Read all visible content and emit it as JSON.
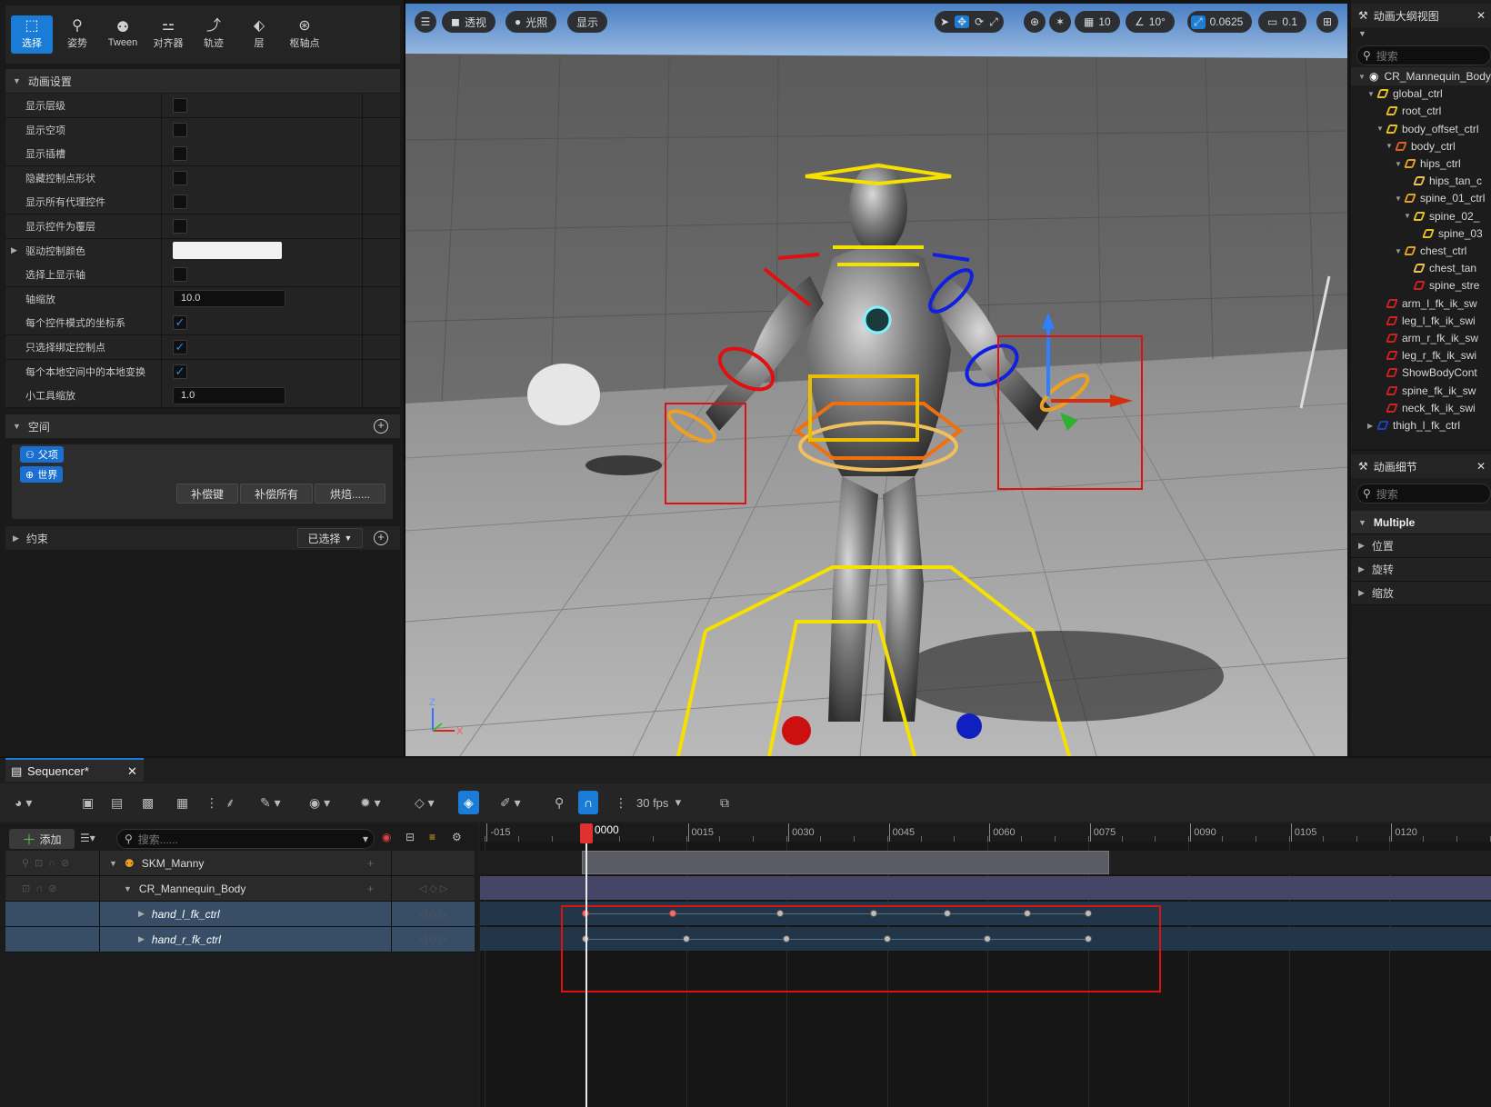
{
  "modes": [
    {
      "label": "选择",
      "icon": "select-icon",
      "active": true
    },
    {
      "label": "姿势",
      "icon": "pose-icon"
    },
    {
      "label": "Tween",
      "icon": "tween-icon"
    },
    {
      "label": "对齐器",
      "icon": "aligner-icon"
    },
    {
      "label": "轨迹",
      "icon": "trail-icon"
    },
    {
      "label": "层",
      "icon": "layers-icon"
    },
    {
      "label": "枢轴点",
      "icon": "pivot-icon"
    }
  ],
  "anim_settings": {
    "title": "动画设置",
    "rows": [
      {
        "label": "显示层级",
        "type": "checkbox",
        "checked": false
      },
      {
        "label": "显示空项",
        "type": "checkbox",
        "checked": false
      },
      {
        "label": "显示插槽",
        "type": "checkbox",
        "checked": false
      },
      {
        "label": "隐藏控制点形状",
        "type": "checkbox",
        "checked": false
      },
      {
        "label": "显示所有代理控件",
        "type": "checkbox",
        "checked": false
      },
      {
        "label": "显示控件为覆层",
        "type": "checkbox",
        "checked": false
      },
      {
        "label": "驱动控制颜色",
        "type": "color"
      },
      {
        "label": "选择上显示轴",
        "type": "checkbox",
        "checked": false
      },
      {
        "label": "轴缩放",
        "type": "number",
        "value": "10.0"
      },
      {
        "label": "每个控件模式的坐标系",
        "type": "checkbox",
        "checked": true
      },
      {
        "label": "只选择绑定控制点",
        "type": "checkbox",
        "checked": true
      },
      {
        "label": "每个本地空间中的本地变换",
        "type": "checkbox",
        "checked": true
      },
      {
        "label": "小工具缩放",
        "type": "number",
        "value": "1.0"
      }
    ]
  },
  "space": {
    "title": "空间",
    "chips": [
      "父项",
      "世界"
    ],
    "buttons": [
      "补偿键",
      "补偿所有",
      "烘焙......"
    ]
  },
  "constraints": {
    "title": "约束",
    "dropdown": "已选择"
  },
  "viewport": {
    "menu_icon": "hamburger-icon",
    "perspective": "透视",
    "lit": "光照",
    "show": "显示",
    "grid_snap": "10",
    "rot_snap": "10°",
    "scale_snap": "0.0625",
    "cam_speed": "0.1"
  },
  "outliner": {
    "title": "动画大纲视图",
    "search_placeholder": "搜索",
    "items": [
      {
        "label": "CR_Mannequin_Body",
        "indent": 0,
        "color": "#ffffff",
        "eye": true
      },
      {
        "label": "global_ctrl",
        "indent": 1,
        "color": "#e8c020"
      },
      {
        "label": "root_ctrl",
        "indent": 2,
        "color": "#e8c020"
      },
      {
        "label": "body_offset_ctrl",
        "indent": 2,
        "color": "#e8c020"
      },
      {
        "label": "body_ctrl",
        "indent": 3,
        "color": "#e06020"
      },
      {
        "label": "hips_ctrl",
        "indent": 4,
        "color": "#e8a020"
      },
      {
        "label": "hips_tan_c",
        "indent": 5,
        "color": "#f0c050"
      },
      {
        "label": "spine_01_ctrl",
        "indent": 4,
        "color": "#e8a020"
      },
      {
        "label": "spine_02_",
        "indent": 5,
        "color": "#e8c020"
      },
      {
        "label": "spine_03",
        "indent": 6,
        "color": "#e8c020"
      },
      {
        "label": "chest_ctrl",
        "indent": 4,
        "color": "#e8a020"
      },
      {
        "label": "chest_tan",
        "indent": 5,
        "color": "#f0c050"
      },
      {
        "label": "spine_stre",
        "indent": 5,
        "color": "#d02020"
      },
      {
        "label": "arm_l_fk_ik_sw",
        "indent": 2,
        "color": "#d02020"
      },
      {
        "label": "leg_l_fk_ik_swi",
        "indent": 2,
        "color": "#d02020"
      },
      {
        "label": "arm_r_fk_ik_sw",
        "indent": 2,
        "color": "#d02020"
      },
      {
        "label": "leg_r_fk_ik_swi",
        "indent": 2,
        "color": "#d02020"
      },
      {
        "label": "ShowBodyCont",
        "indent": 2,
        "color": "#d02020"
      },
      {
        "label": "spine_fk_ik_sw",
        "indent": 2,
        "color": "#d02020"
      },
      {
        "label": "neck_fk_ik_swi",
        "indent": 2,
        "color": "#d02020"
      },
      {
        "label": "thigh_l_fk_ctrl",
        "indent": 1,
        "color": "#2040c0"
      }
    ]
  },
  "details": {
    "title": "动画细节",
    "search_placeholder": "搜索",
    "category": "Multiple",
    "rows": [
      "位置",
      "旋转",
      "缩放"
    ]
  },
  "sequencer": {
    "tab": "Sequencer*",
    "fps": "30 fps",
    "add_label": "添加",
    "search_placeholder": "搜索......",
    "current_frame": "0000",
    "ticks": [
      "-015",
      "0015",
      "0030",
      "0045",
      "0060",
      "0075",
      "0090",
      "0105",
      "0120"
    ],
    "tracks": [
      {
        "label": "SKM_Manny",
        "level": 0
      },
      {
        "label": "CR_Mannequin_Body",
        "level": 1
      },
      {
        "label": "hand_l_fk_ctrl",
        "level": 2,
        "selected": true
      },
      {
        "label": "hand_r_fk_ctrl",
        "level": 2,
        "selected": true
      }
    ],
    "keys_hand_l": [
      0,
      13,
      29,
      43,
      54,
      66,
      75
    ],
    "keys_hand_r": [
      0,
      15,
      30,
      45,
      60,
      75
    ]
  }
}
